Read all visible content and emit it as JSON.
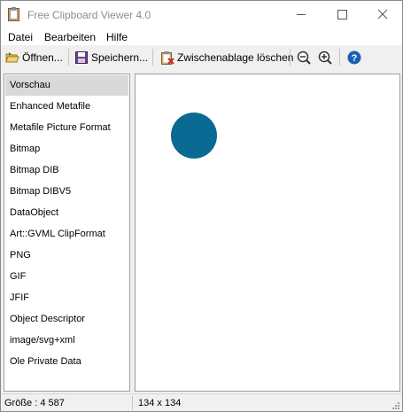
{
  "window": {
    "title": "Free Clipboard Viewer 4.0"
  },
  "menu": {
    "items": [
      "Datei",
      "Bearbeiten",
      "Hilfe"
    ]
  },
  "toolbar": {
    "open_label": "Öffnen...",
    "save_label": "Speichern...",
    "clear_label": "Zwischenablage löschen"
  },
  "formats": [
    "Vorschau",
    "Enhanced Metafile",
    "Metafile Picture Format",
    "Bitmap",
    "Bitmap DIB",
    "Bitmap DIBV5",
    "DataObject",
    "Art::GVML ClipFormat",
    "PNG",
    "GIF",
    "JFIF",
    "Object Descriptor",
    "image/svg+xml",
    "Ole Private Data"
  ],
  "selected_format": "Vorschau",
  "preview": {
    "shape": "circle",
    "color": "#0a6a93"
  },
  "status": {
    "size": "Größe : 4 587",
    "dimensions": "134 x 134"
  },
  "colors": {
    "selection": "#d9d9d9",
    "help_icon": "#1c5fb2"
  }
}
